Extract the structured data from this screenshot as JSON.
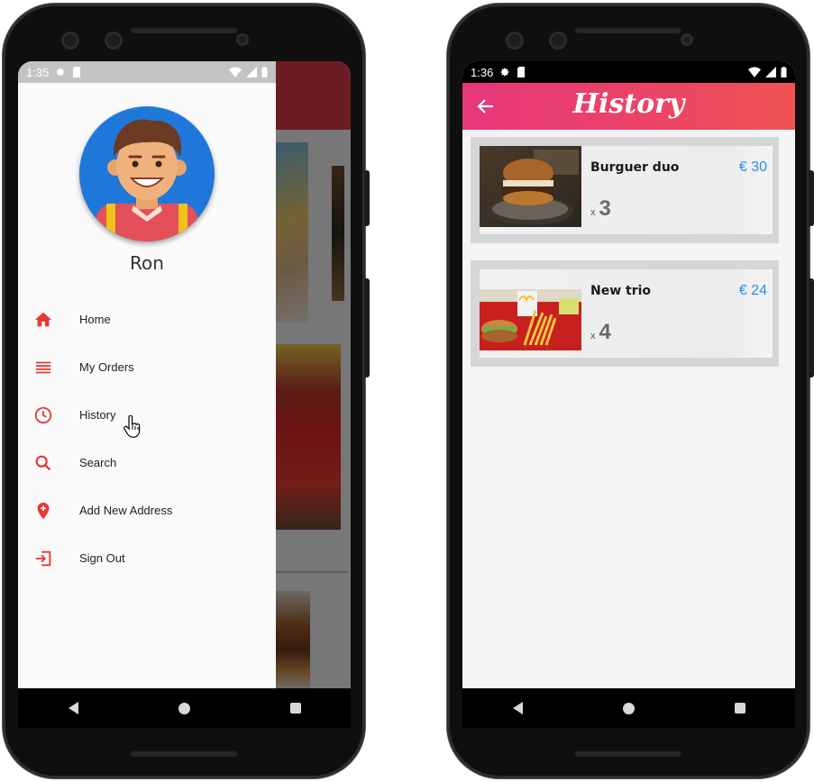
{
  "left_phone": {
    "status": {
      "time": "1:35"
    },
    "drawer": {
      "user_name": "Ron",
      "menu": [
        {
          "label": "Home",
          "icon": "home-icon"
        },
        {
          "label": "My Orders",
          "icon": "list-icon"
        },
        {
          "label": "History",
          "icon": "clock-icon"
        },
        {
          "label": "Search",
          "icon": "search-icon"
        },
        {
          "label": "Add New Address",
          "icon": "add-location-icon"
        },
        {
          "label": "Sign Out",
          "icon": "sign-out-icon"
        }
      ]
    }
  },
  "right_phone": {
    "status": {
      "time": "1:36"
    },
    "appbar": {
      "title": "History"
    },
    "orders": [
      {
        "name": "Burguer duo",
        "price": "€ 30",
        "qty_prefix": "x",
        "qty": "3"
      },
      {
        "name": "New trio",
        "price": "€ 24",
        "qty_prefix": "x",
        "qty": "4"
      }
    ]
  },
  "colors": {
    "accent_red": "#e53935",
    "appbar_gradient_start": "#e6377a",
    "appbar_gradient_end": "#ef5350",
    "price_blue": "#2c8ee0"
  }
}
